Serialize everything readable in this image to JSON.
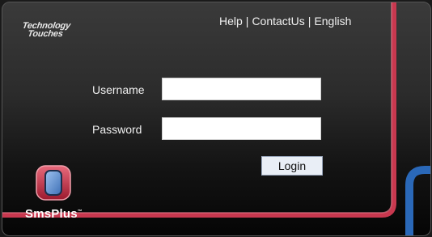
{
  "brand": {
    "line1": "Technology",
    "line2": "Touches"
  },
  "nav": {
    "help": "Help",
    "contact": "ContactUs",
    "language": "English",
    "separator": "|"
  },
  "form": {
    "username_label": "Username",
    "username_value": "",
    "password_label": "Password",
    "password_value": "",
    "login_label": "Login"
  },
  "app": {
    "name": "SmsPlus",
    "trademark": "™"
  },
  "colors": {
    "accent_pink": "#c8384f",
    "accent_blue": "#2a68b8",
    "background": "#1c1c1c"
  }
}
